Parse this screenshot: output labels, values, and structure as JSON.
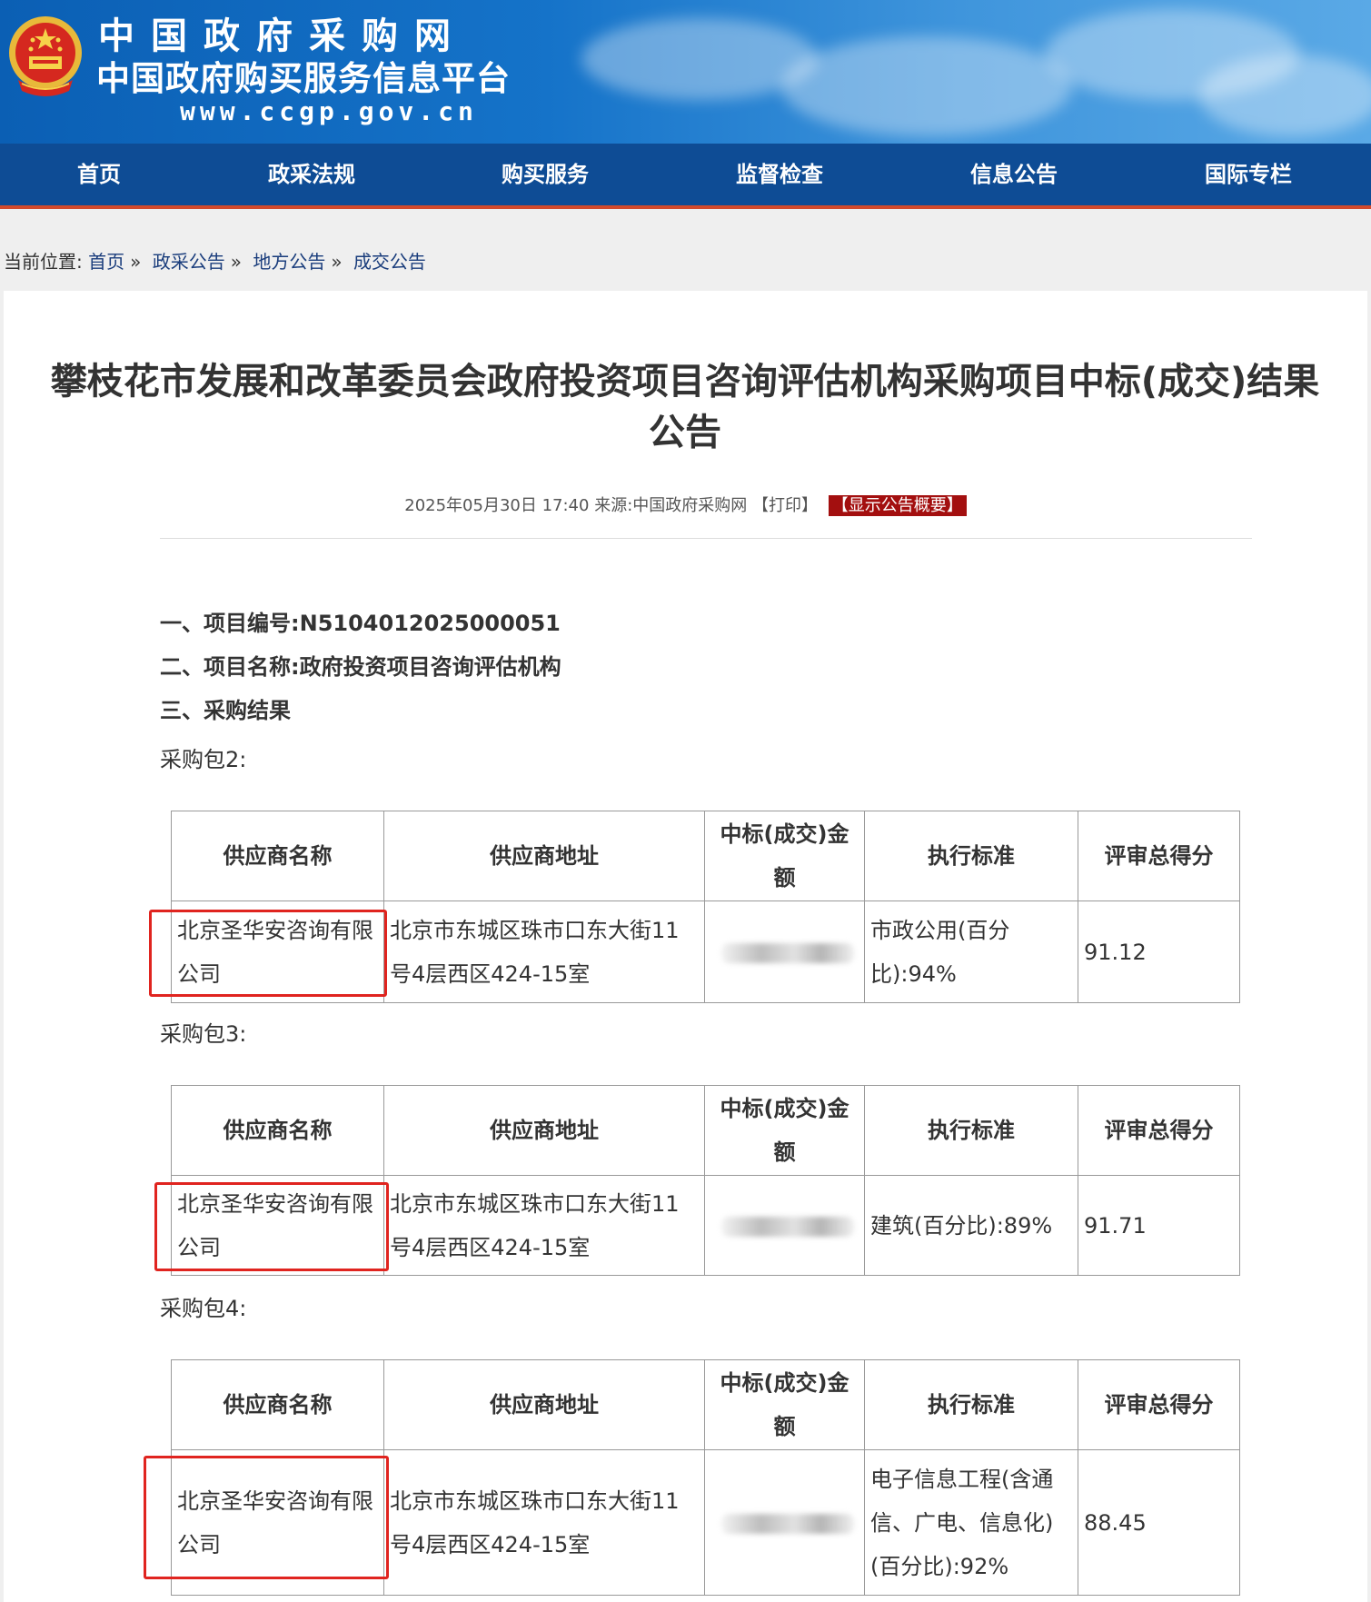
{
  "header": {
    "site_title": "中国政府采购网",
    "site_subtitle": "中国政府购买服务信息平台",
    "site_url": "www.ccgp.gov.cn",
    "emblem_icon": "national-emblem-icon"
  },
  "nav": {
    "items": [
      {
        "label": "首页"
      },
      {
        "label": "政采法规"
      },
      {
        "label": "购买服务"
      },
      {
        "label": "监督检查"
      },
      {
        "label": "信息公告"
      },
      {
        "label": "国际专栏"
      }
    ]
  },
  "breadcrumb": {
    "prefix": "当前位置:",
    "items": [
      "首页",
      "政采公告",
      "地方公告",
      "成交公告"
    ],
    "separator": "»"
  },
  "article": {
    "title_line1": "攀枝花市发展和改革委员会政府投资项目咨询评估机构采购项目中标(成交)结果",
    "title_line2": "公告",
    "date": "2025年05月30日 17:40",
    "source_label": "来源:",
    "source": "中国政府采购网",
    "print_label": "【打印】",
    "summary_label": "【显示公告概要】"
  },
  "sections": {
    "s1_label": "一、项目编号:",
    "s1_value": "N5104012025000051",
    "s2_label": "二、项目名称:",
    "s2_value": "政府投资项目咨询评估机构",
    "s3_label": "三、采购结果"
  },
  "table_headers": {
    "supplier_name": "供应商名称",
    "supplier_address": "供应商地址",
    "amount_line1": "中标(成交)金",
    "amount_line2": "额",
    "standard": "执行标准",
    "score": "评审总得分"
  },
  "packages": [
    {
      "label": "采购包2:",
      "supplier_name": "北京圣华安咨询有限公司",
      "supplier_address": "北京市东城区珠市口东大街11号4层西区424-15室",
      "standard": "市政公用(百分比):94%",
      "score": "91.12"
    },
    {
      "label": "采购包3:",
      "supplier_name": "北京圣华安咨询有限公司",
      "supplier_address": "北京市东城区珠市口东大街11号4层西区424-15室",
      "standard": "建筑(百分比):89%",
      "score": "91.71"
    },
    {
      "label": "采购包4:",
      "supplier_name": "北京圣华安咨询有限公司",
      "supplier_address": "北京市东城区珠市口东大街11号4层西区424-15室",
      "standard": "电子信息工程(含通信、广电、信息化)(百分比):92%",
      "score": "88.45"
    }
  ],
  "colors": {
    "nav_bg": "#0e4c95",
    "banner_blue": "#1573c9",
    "badge_red": "#a30f0f",
    "highlight_box": "#e0241f"
  }
}
